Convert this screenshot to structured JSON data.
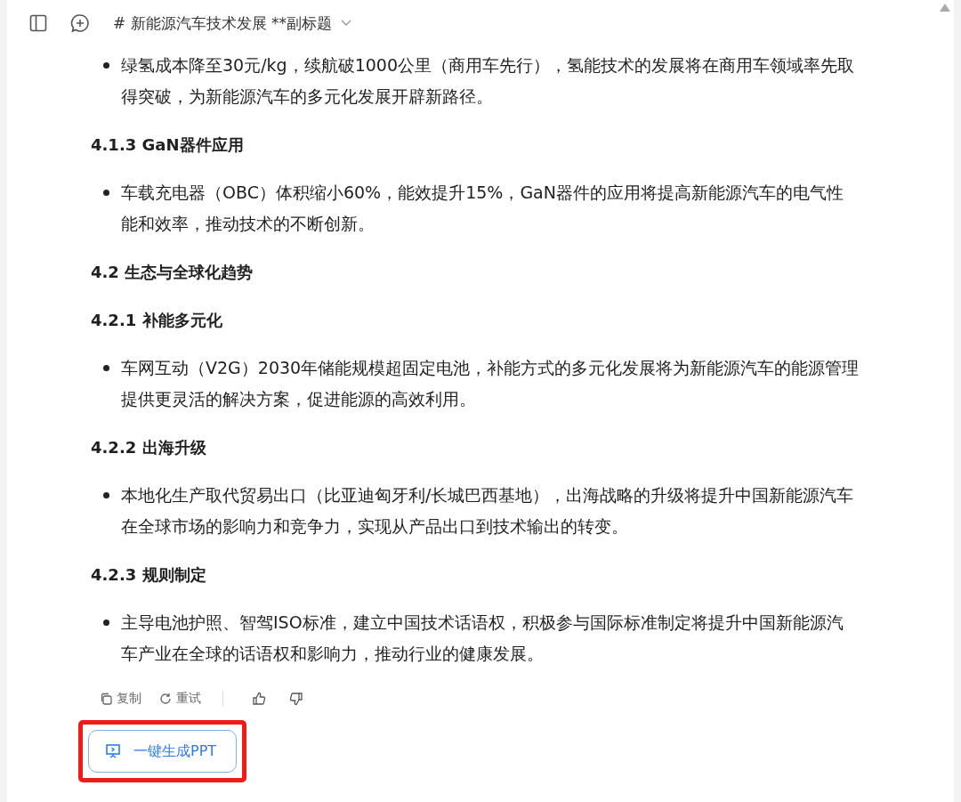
{
  "header": {
    "title": "# 新能源汽车技术发展 **副标题"
  },
  "blocks": [
    {
      "kind": "bullet",
      "text": "绿氢成本降至30元/kg，续航破1000公里（商用车先行），氢能技术的发展将在商用车领域率先取得突破，为新能源汽车的多元化发展开辟新路径。"
    },
    {
      "kind": "heading",
      "text": "4.1.3 GaN器件应用"
    },
    {
      "kind": "bullet",
      "text": "车载充电器（OBC）体积缩小60%，能效提升15%，GaN器件的应用将提高新能源汽车的电气性能和效率，推动技术的不断创新。"
    },
    {
      "kind": "heading",
      "text": "4.2 生态与全球化趋势"
    },
    {
      "kind": "heading",
      "text": "4.2.1 补能多元化"
    },
    {
      "kind": "bullet",
      "text": "车网互动（V2G）2030年储能规模超固定电池，补能方式的多元化发展将为新能源汽车的能源管理提供更灵活的解决方案，促进能源的高效利用。"
    },
    {
      "kind": "heading",
      "text": "4.2.2 出海升级"
    },
    {
      "kind": "bullet",
      "text": "本地化生产取代贸易出口（比亚迪匈牙利/长城巴西基地），出海战略的升级将提升中国新能源汽车在全球市场的影响力和竞争力，实现从产品出口到技术输出的转变。"
    },
    {
      "kind": "heading",
      "text": "4.2.3 规则制定"
    },
    {
      "kind": "bullet",
      "text": "主导电池护照、智驾ISO标准，建立中国技术话语权，积极参与国际标准制定将提升中国新能源汽车产业在全球的话语权和影响力，推动行业的健康发展。"
    }
  ],
  "actions": {
    "copy": "复制",
    "retry": "重试"
  },
  "ppt_button": {
    "label": "一键生成PPT",
    "highlighted": true
  }
}
